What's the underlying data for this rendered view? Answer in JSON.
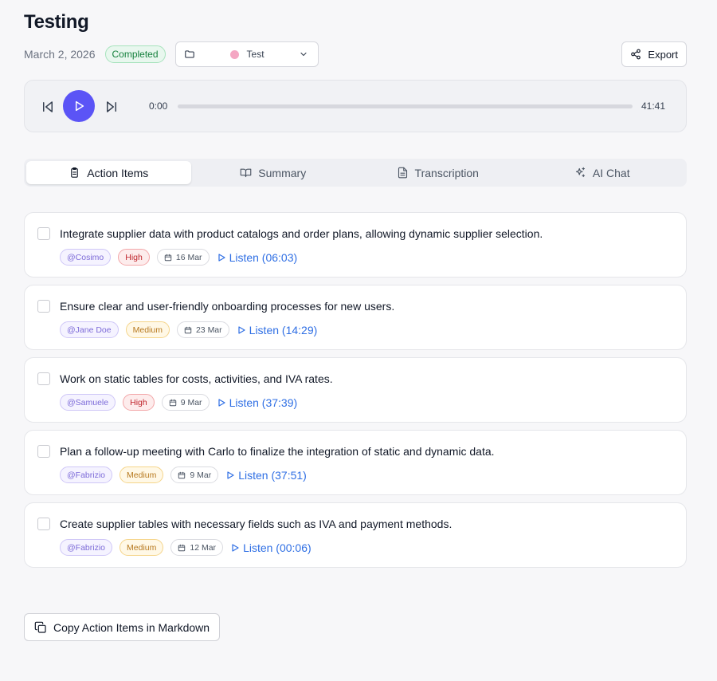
{
  "header": {
    "title": "Testing",
    "date": "March 2, 2026",
    "status": "Completed",
    "folder": {
      "name": "Test",
      "color": "#f4a7c3"
    },
    "export_label": "Export"
  },
  "player": {
    "current_time": "0:00",
    "total_time": "41:41",
    "progress": 0
  },
  "tabs": [
    {
      "label": "Action Items",
      "icon": "clipboard-list-icon",
      "active": true
    },
    {
      "label": "Summary",
      "icon": "book-open-icon",
      "active": false
    },
    {
      "label": "Transcription",
      "icon": "file-text-icon",
      "active": false
    },
    {
      "label": "AI Chat",
      "icon": "sparkles-icon",
      "active": false
    }
  ],
  "action_items": [
    {
      "text": "Integrate supplier data with product catalogs and order plans, allowing dynamic supplier selection.",
      "assignee": "@Cosimo",
      "priority": "High",
      "due": "16 Mar",
      "listen": "Listen (06:03)"
    },
    {
      "text": "Ensure clear and user-friendly onboarding processes for new users.",
      "assignee": "@Jane Doe",
      "priority": "Medium",
      "due": "23 Mar",
      "listen": "Listen (14:29)"
    },
    {
      "text": "Work on static tables for costs, activities, and IVA rates.",
      "assignee": "@Samuele",
      "priority": "High",
      "due": "9 Mar",
      "listen": "Listen (37:39)"
    },
    {
      "text": "Plan a follow-up meeting with Carlo to finalize the integration of static and dynamic data.",
      "assignee": "@Fabrizio",
      "priority": "Medium",
      "due": "9 Mar",
      "listen": "Listen (37:51)"
    },
    {
      "text": "Create supplier tables with necessary fields such as IVA and payment methods.",
      "assignee": "@Fabrizio",
      "priority": "Medium",
      "due": "12 Mar",
      "listen": "Listen (00:06)"
    }
  ],
  "copy_button_label": "Copy Action Items in Markdown",
  "colors": {
    "accent": "#5b54f6",
    "link": "#2f6fe4",
    "status_green": "#15803d",
    "priority_high": "#c0262d",
    "priority_medium": "#b7791f"
  }
}
